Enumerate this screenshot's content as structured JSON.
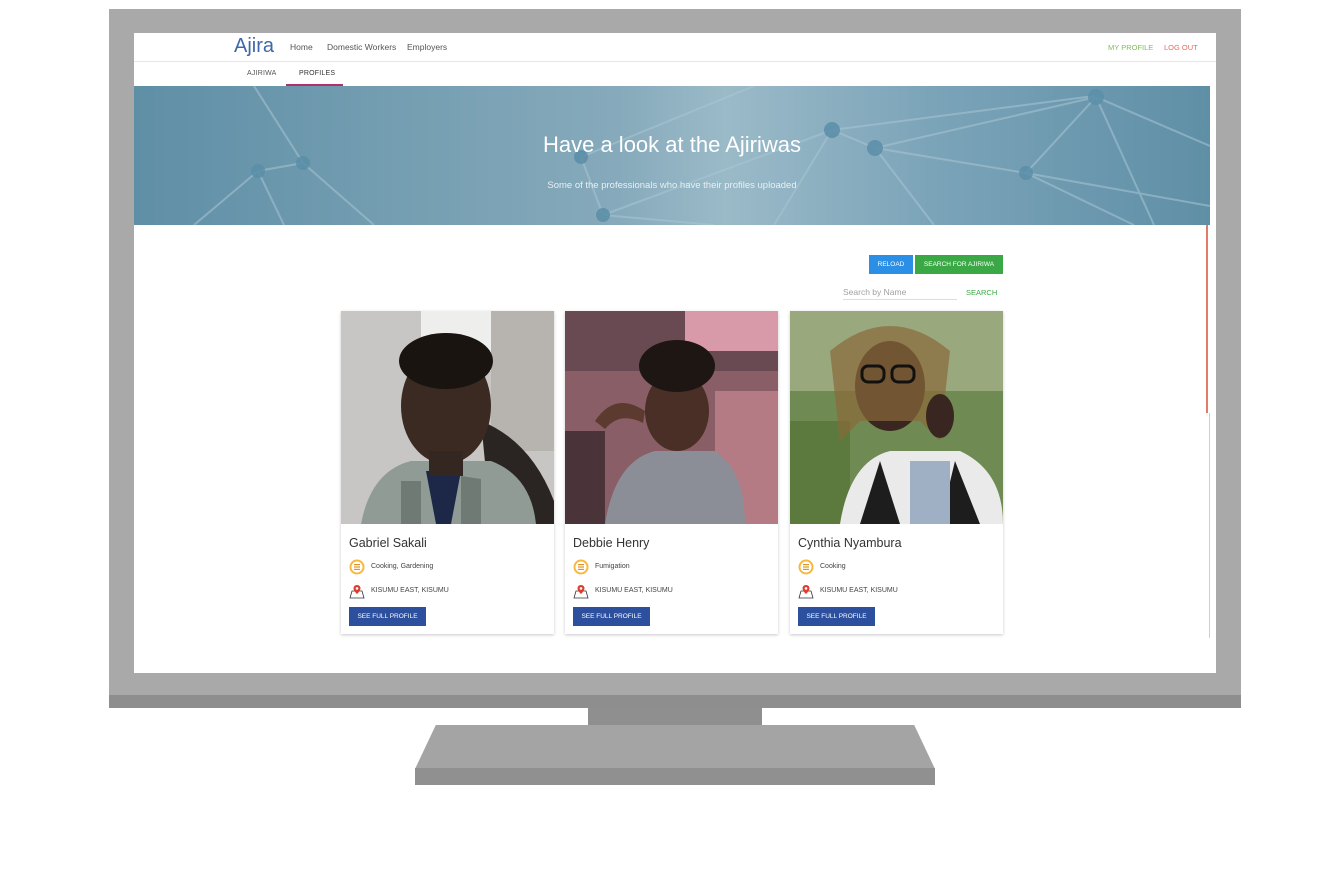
{
  "app": {
    "brand": "Ajira",
    "nav_links": [
      "Home",
      "Domestic Workers",
      "Employers"
    ],
    "my_profile": "MY PROFILE",
    "log_out": "LOG OUT",
    "subtabs": [
      "AJIRIWA",
      "PROFILES"
    ],
    "active_subtab": "PROFILES"
  },
  "hero": {
    "title": "Have a look at the Ajiriwas",
    "subtitle": "Some of the professionals who have their profiles uploaded"
  },
  "toolbar": {
    "reload_label": "RELOAD",
    "search_ajiriwa_label": "SEARCH FOR AJIRIWA",
    "search_placeholder": "Search by Name",
    "search_value": "",
    "search_label": "SEARCH"
  },
  "profiles": [
    {
      "name": "Gabriel Sakali",
      "skills": "Cooking, Gardening",
      "location": "KISUMU EAST, KISUMU",
      "button": "SEE FULL PROFILE"
    },
    {
      "name": "Debbie Henry",
      "skills": "Fumigation",
      "location": "KISUMU EAST, KISUMU",
      "button": "SEE FULL PROFILE"
    },
    {
      "name": "Cynthia Nyambura",
      "skills": "Cooking",
      "location": "KISUMU EAST, KISUMU",
      "button": "SEE FULL PROFILE"
    }
  ],
  "colors": {
    "brand": "#3f68a8",
    "my_profile": "#7cbf5a",
    "log_out": "#e86b5a",
    "reload": "#2b8fe6",
    "search_green": "#3aa845",
    "profile_button": "#2c4f9e",
    "active_tab_underline": "#b0306e"
  },
  "icons": {
    "skills": "skills-list-icon",
    "location": "map-pin-icon"
  }
}
